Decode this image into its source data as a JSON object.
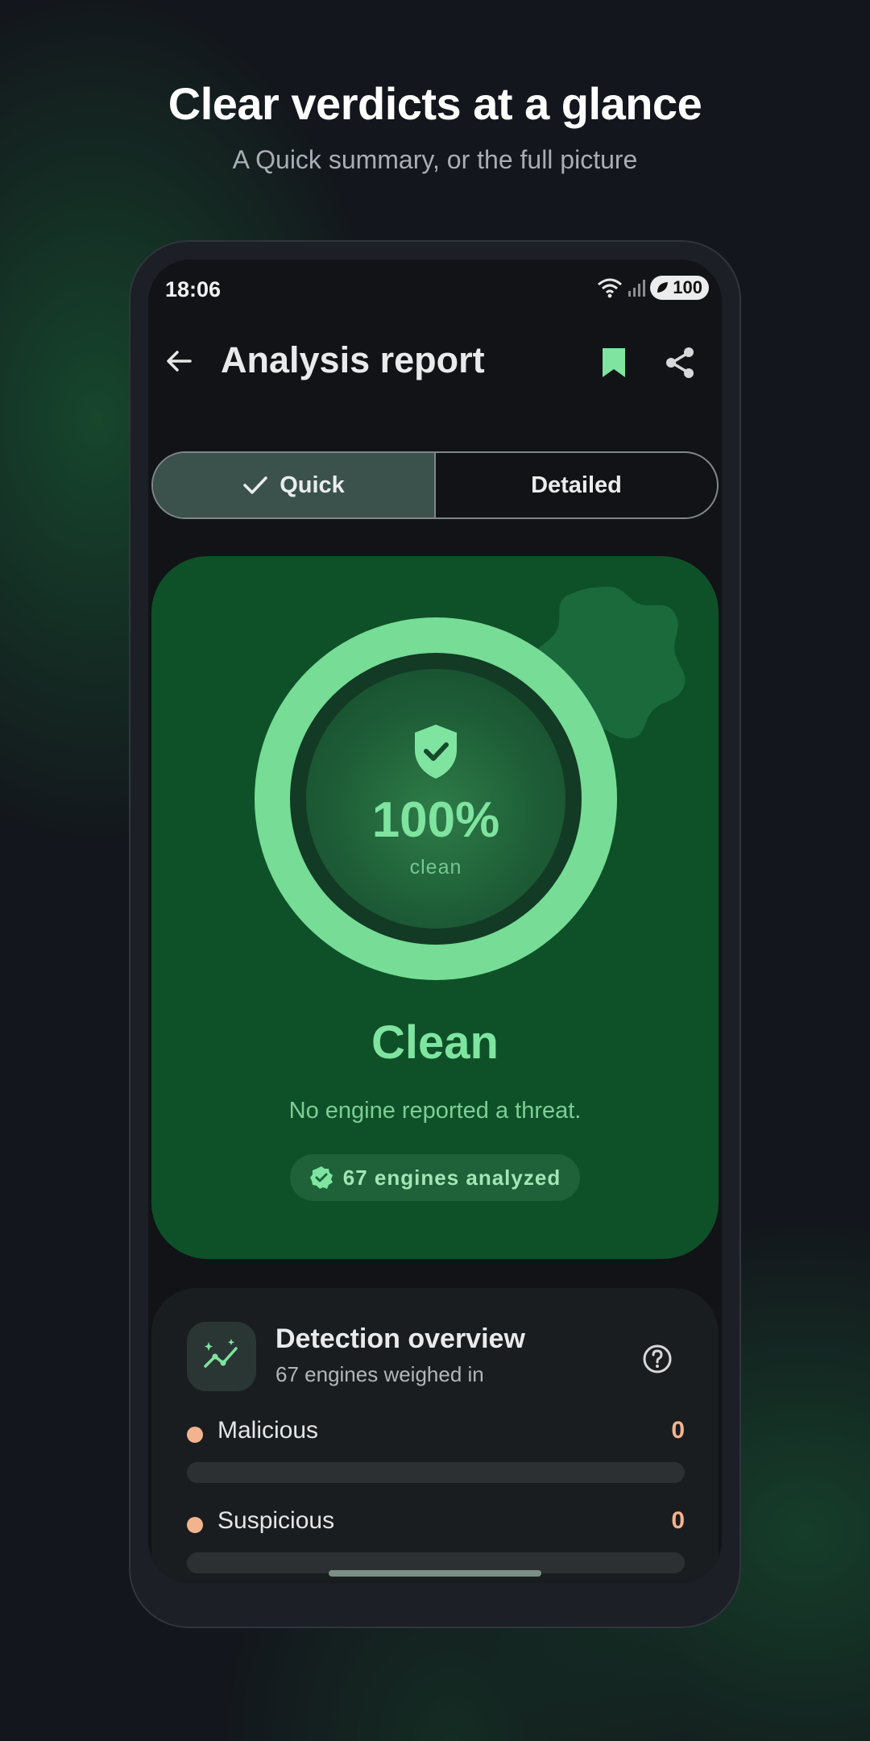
{
  "promo": {
    "headline": "Clear verdicts at a glance",
    "subheadline": "A Quick summary, or the full picture"
  },
  "status_bar": {
    "time": "18:06",
    "battery": "100"
  },
  "app_bar": {
    "title": "Analysis report",
    "back_icon": "arrow-left-icon",
    "bookmark_icon": "bookmark-icon",
    "share_icon": "share-icon"
  },
  "view_toggle": {
    "options": [
      {
        "label": "Quick",
        "selected": true
      },
      {
        "label": "Detailed",
        "selected": false
      }
    ]
  },
  "verdict": {
    "percent": "100%",
    "percent_label": "clean",
    "title": "Clean",
    "description": "No engine reported a threat.",
    "engines_chip": "67 engines analyzed"
  },
  "detection_overview": {
    "title": "Detection overview",
    "subtitle": "67 engines weighed in",
    "categories": [
      {
        "label": "Malicious",
        "count": "0"
      },
      {
        "label": "Suspicious",
        "count": "0"
      }
    ]
  },
  "colors": {
    "accent_green": "#7fe4a0",
    "card_green": "#0e5128",
    "warning_orange": "#f2b48f",
    "background": "#13161c"
  }
}
